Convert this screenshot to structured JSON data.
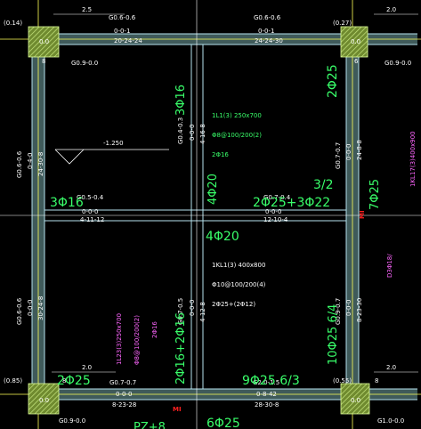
{
  "colors": {
    "background": "#000000",
    "beam_fill": "#3f5a5a",
    "grid_line": "#ffffff",
    "axis_line": "#ffff55",
    "text_white": "#ffffff",
    "text_green": "#39ff6a",
    "text_magenta": "#ff66ff",
    "text_red": "#ff2020",
    "text_cyan": "#8ff4ff",
    "column_fill": "#a6cc63",
    "beam_edge": "#b6e2ee"
  },
  "columns": {
    "top_left": {
      "tag": "(0.14)",
      "label": "0.0",
      "dim": "8"
    },
    "top_right": {
      "tag": "(0.27)",
      "label": "0.0",
      "dim": "6"
    },
    "bottom_left": {
      "tag": "(0.85)",
      "label": "0.0",
      "dim": "8"
    },
    "bottom_right": {
      "tag": "(0.55)",
      "label": "0.0",
      "dim": "8"
    }
  },
  "top_dims": {
    "left": "2.5",
    "right": "2.0"
  },
  "bottom_dims": {
    "left": "2.0",
    "right": "2.0"
  },
  "beam_tags": {
    "top_left_beam": {
      "id": "G0.6-0.6",
      "top": "0-0-1",
      "bottom": "20-24-24"
    },
    "top_right_beam": {
      "id": "G0.6-0.6",
      "top": "0-0-1",
      "bottom": "24-24-30"
    },
    "left_stub": "G0.9-0.0",
    "right_stub": "G0.9-0.0",
    "left_col_vertical": "G0.6-0.6",
    "left_col_top": "0-4-0",
    "left_col_bottom": "24-30-8",
    "left_col_lower_tag": "G0.6-0.6",
    "left_col_lower_top": "0-0-0",
    "left_col_lower_bottom": "30-24-8",
    "mid_left": {
      "id": "G0.5-0.4",
      "top": "0-0-0",
      "bottom": "4-11-12"
    },
    "mid_right": {
      "id": "G0.7-0.4",
      "top": "0-0-0",
      "bottom": "12-10-4"
    },
    "center_vertical": "G0.4-0.3",
    "center_vertical_top": "0-0-0",
    "center_vertical_bottom": "4-16-8",
    "right_vertical": "G0.7-0.7",
    "right_vertical_top": "0-0-0",
    "right_vertical_bottom": "24-8-8",
    "right_lower_vertical": "G0.9-0.7",
    "right_lower_top": "0-0-0",
    "right_lower_bottom": "8-23-30",
    "inner_left_vertical": "G0.7-0.5",
    "inner_left_top": "0-0-0",
    "inner_left_bottom": "4-12-8",
    "bottom_left_beam": {
      "id": "G0.7-0.7",
      "top": "0-0-0",
      "bottom": "8-23-28"
    },
    "bottom_right_beam": {
      "id": "G2.0-1.5",
      "top": "0-8-42",
      "bottom": "28-30-8"
    },
    "bottom_left_stub": "G0.9-0.0",
    "bottom_right_stub": "G1.0-0.0"
  },
  "elevation": "-1.250",
  "rebar": {
    "r_3d16_top": "3Φ16",
    "r_3d16_left": "3Φ16",
    "r_2d25_right": "2Φ25",
    "r_4d20_mid": "4Φ20",
    "r_4d20_lower": "4Φ20",
    "r_2d25_3d22": "2Φ25+3Φ22",
    "r_3_2": "3/2",
    "r_7d25": "7Φ25",
    "r_2d25_bottom": "2Φ25",
    "r_6d25": "6Φ25",
    "r_9d25": "9Φ25 6/3",
    "r_10d25": "10Φ25 6/4",
    "r_2d16_2d16": "2Φ16+2Φ16",
    "r_pz": "PZ+8"
  },
  "beam_1L1": {
    "line1": "1L1(3) 250x700",
    "line2": "Φ8@100/200(2)",
    "line3": "2Φ16"
  },
  "beam_1KL1": {
    "line1": "1KL1(3) 400x800",
    "line2": "Φ10@100/200(4)",
    "line3": "2Φ25+(2Φ12)"
  },
  "beam_1L23": {
    "line1": "1L23(3)250x700",
    "line2": "Φ8@100/200(2)",
    "line3": "2Φ16"
  },
  "beam_1KL17": {
    "line1": "1KL17(3)400x900"
  },
  "beam_D3": {
    "line1": "D3Φ18/"
  },
  "marker_MI": "MI"
}
